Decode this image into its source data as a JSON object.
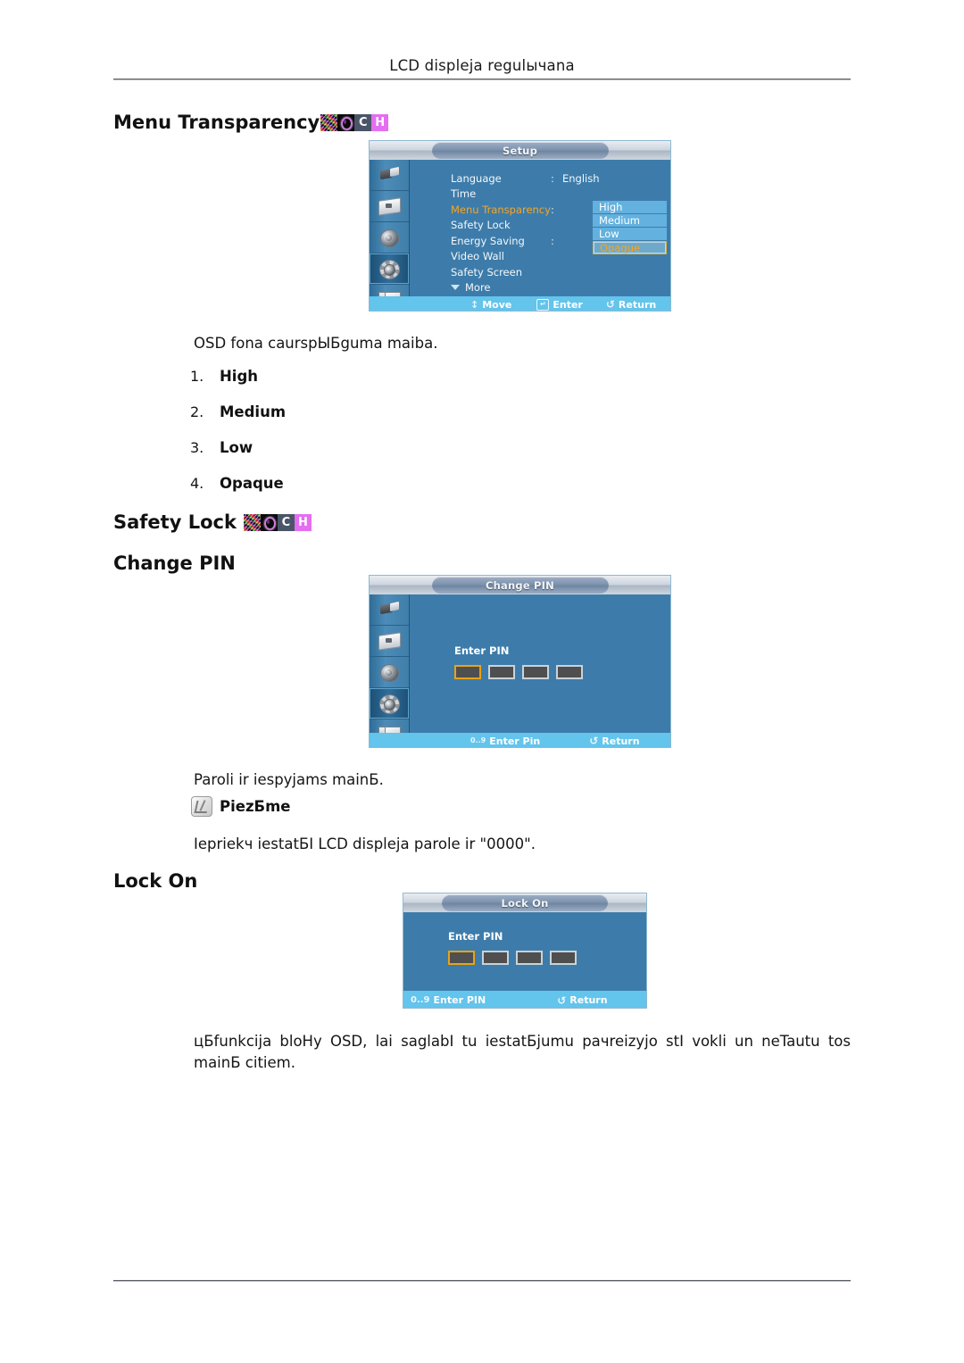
{
  "header": {
    "running_title": "LCD displeja regulычana"
  },
  "sections": {
    "menu_transparency": {
      "heading": "Menu Transparency",
      "badges": [
        "noise-badge",
        "O",
        "C",
        "H"
      ],
      "description": "OSD fona caurspЫБguma maiba.",
      "options": [
        {
          "num": "1.",
          "label": "High"
        },
        {
          "num": "2.",
          "label": "Medium"
        },
        {
          "num": "3.",
          "label": "Low"
        },
        {
          "num": "4.",
          "label": "Opaque"
        }
      ]
    },
    "safety_lock": {
      "heading": "Safety Lock",
      "badges": [
        "noise-badge",
        "O",
        "C",
        "H"
      ]
    },
    "change_pin": {
      "heading": "Change PIN",
      "description": "Paroli ir iespyjams mainБ.",
      "note_label": "PiezБme",
      "note_text": "Iepriekч iestatБI LCD displeja parole ir \"0000\"."
    },
    "lock_on": {
      "heading": "Lock On",
      "description": "цБfunkcija bloHy OSD, lai saglabI tu iestatБjumu paчreizyjo stI vokli un neTautu tos mainБ citiem."
    }
  },
  "osd_setup": {
    "title": "Setup",
    "rail_icons": [
      "input-icon",
      "picture-icon",
      "sound-icon",
      "gear-icon",
      "multi-control-icon"
    ],
    "active_rail_index": 3,
    "rows": [
      {
        "label": "Language",
        "colon": ":",
        "value": "English",
        "selected": false
      },
      {
        "label": "Time",
        "colon": "",
        "value": "",
        "selected": false
      },
      {
        "label": "Menu Transparency",
        "colon": ":",
        "value": "",
        "selected": true
      },
      {
        "label": "Safety Lock",
        "colon": "",
        "value": "",
        "selected": false
      },
      {
        "label": "Energy Saving",
        "colon": ":",
        "value": "",
        "selected": false
      },
      {
        "label": "Video Wall",
        "colon": "",
        "value": "",
        "selected": false
      },
      {
        "label": "Safety Screen",
        "colon": "",
        "value": "",
        "selected": false
      }
    ],
    "more_label": "More",
    "dropdown": [
      "High",
      "Medium",
      "Low",
      "Opaque"
    ],
    "dropdown_current": "Opaque",
    "footer": [
      {
        "glyph": "↕",
        "label": "Move"
      },
      {
        "glyph": "↵",
        "label": "Enter"
      },
      {
        "glyph": "↺",
        "label": "Return"
      }
    ]
  },
  "osd_change_pin": {
    "title": "Change PIN",
    "rail_icons": [
      "input-icon",
      "picture-icon",
      "sound-icon",
      "gear-icon",
      "multi-control-icon"
    ],
    "pin_label": "Enter PIN",
    "pin_digits": [
      "",
      "",
      "",
      ""
    ],
    "footer": [
      {
        "glyph": "0..9",
        "label": "Enter Pin"
      },
      {
        "glyph": "↺",
        "label": "Return"
      }
    ]
  },
  "osd_lock_on": {
    "title": "Lock On",
    "pin_label": "Enter PIN",
    "pin_digits": [
      "",
      "",
      "",
      ""
    ],
    "footer": [
      {
        "glyph": "0..9",
        "label": "Enter PIN"
      },
      {
        "glyph": "↺",
        "label": "Return"
      }
    ]
  },
  "colors": {
    "osd_blue": "#3d7caa",
    "osd_footer": "#63c4ec",
    "highlight_orange": "#f5a623",
    "dropdown_blue": "#63b1df"
  }
}
